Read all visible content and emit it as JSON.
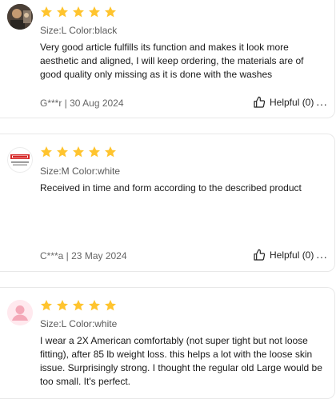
{
  "reviews": [
    {
      "avatar_icon": "user-photo-icon",
      "rating": 5,
      "sku": "Size:L Color:black",
      "text": "Very good article fulfills its function and makes it look more aesthetic and aligned, I will keep ordering, the materials are of good quality only missing as it is done with the washes",
      "meta": "G***r | 30 Aug 2024",
      "helpful": "Helpful (0)"
    },
    {
      "avatar_icon": "store-logo-icon",
      "rating": 5,
      "sku": "Size:M Color:white",
      "text": "Received in time and form according to the described product",
      "meta": "C***a | 23 May 2024",
      "helpful": "Helpful (0)"
    },
    {
      "avatar_icon": "default-user-icon",
      "rating": 5,
      "sku": "Size:L Color:white",
      "text": "I wear a 2X American comfortably (not super tight but not loose fitting), after 85 lb weight loss. this helps a lot with the loose skin issue. Surprisingly strong. I thought the regular old Large would be too small. It's perfect."
    }
  ],
  "colors": {
    "star": "#FFC42E",
    "avatar_bg": "#FFE9EE"
  },
  "icons": {
    "star": "star-icon",
    "thumb": "thumbs-up-icon",
    "more": "more-icon"
  },
  "more_label": "···"
}
